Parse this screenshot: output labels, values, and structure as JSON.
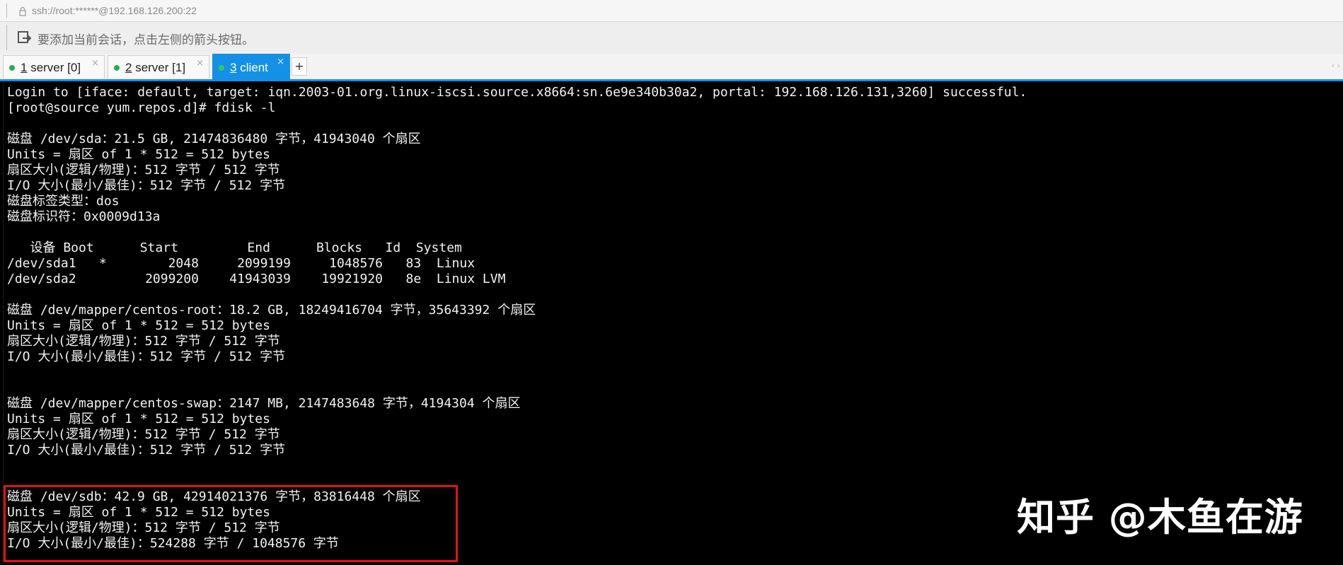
{
  "address": {
    "url": "ssh://root:******@192.168.126.200:22"
  },
  "hint": {
    "text": "要添加当前会话，点击左侧的箭头按钮。"
  },
  "tabs": [
    {
      "num": "1",
      "label": " server [0]",
      "active": false
    },
    {
      "num": "2",
      "label": " server [1]",
      "active": false
    },
    {
      "num": "3",
      "label": " client",
      "active": true
    }
  ],
  "tab_close_glyph": "×",
  "new_tab_glyph": "+",
  "tab_scroll_glyph": "‹ ›",
  "colors": {
    "accent": "#1491e6",
    "status_dot": "#21b14b",
    "highlight_border": "#e0131b",
    "terminal_bg": "#000000",
    "terminal_fg": "#f2f2f2"
  },
  "terminal": {
    "lines": [
      "Login to [iface: default, target: iqn.2003-01.org.linux-iscsi.source.x8664:sn.6e9e340b30a2, portal: 192.168.126.131,3260] successful.",
      "[root@source yum.repos.d]# fdisk -l",
      "",
      "磁盘 /dev/sda：21.5 GB, 21474836480 字节，41943040 个扇区",
      "Units = 扇区 of 1 * 512 = 512 bytes",
      "扇区大小(逻辑/物理)：512 字节 / 512 字节",
      "I/O 大小(最小/最佳)：512 字节 / 512 字节",
      "磁盘标签类型：dos",
      "磁盘标识符：0x0009d13a",
      "",
      "   设备 Boot      Start         End      Blocks   Id  System",
      "/dev/sda1   *        2048     2099199     1048576   83  Linux",
      "/dev/sda2         2099200    41943039    19921920   8e  Linux LVM",
      "",
      "磁盘 /dev/mapper/centos-root：18.2 GB, 18249416704 字节，35643392 个扇区",
      "Units = 扇区 of 1 * 512 = 512 bytes",
      "扇区大小(逻辑/物理)：512 字节 / 512 字节",
      "I/O 大小(最小/最佳)：512 字节 / 512 字节",
      "",
      "",
      "磁盘 /dev/mapper/centos-swap：2147 MB, 2147483648 字节，4194304 个扇区",
      "Units = 扇区 of 1 * 512 = 512 bytes",
      "扇区大小(逻辑/物理)：512 字节 / 512 字节",
      "I/O 大小(最小/最佳)：512 字节 / 512 字节",
      "",
      "",
      "磁盘 /dev/sdb：42.9 GB, 42914021376 字节，83816448 个扇区",
      "Units = 扇区 of 1 * 512 = 512 bytes",
      "扇区大小(逻辑/物理)：512 字节 / 512 字节",
      "I/O 大小(最小/最佳)：524288 字节 / 1048576 字节"
    ]
  },
  "watermark": {
    "text": "知乎 @木鱼在游"
  }
}
